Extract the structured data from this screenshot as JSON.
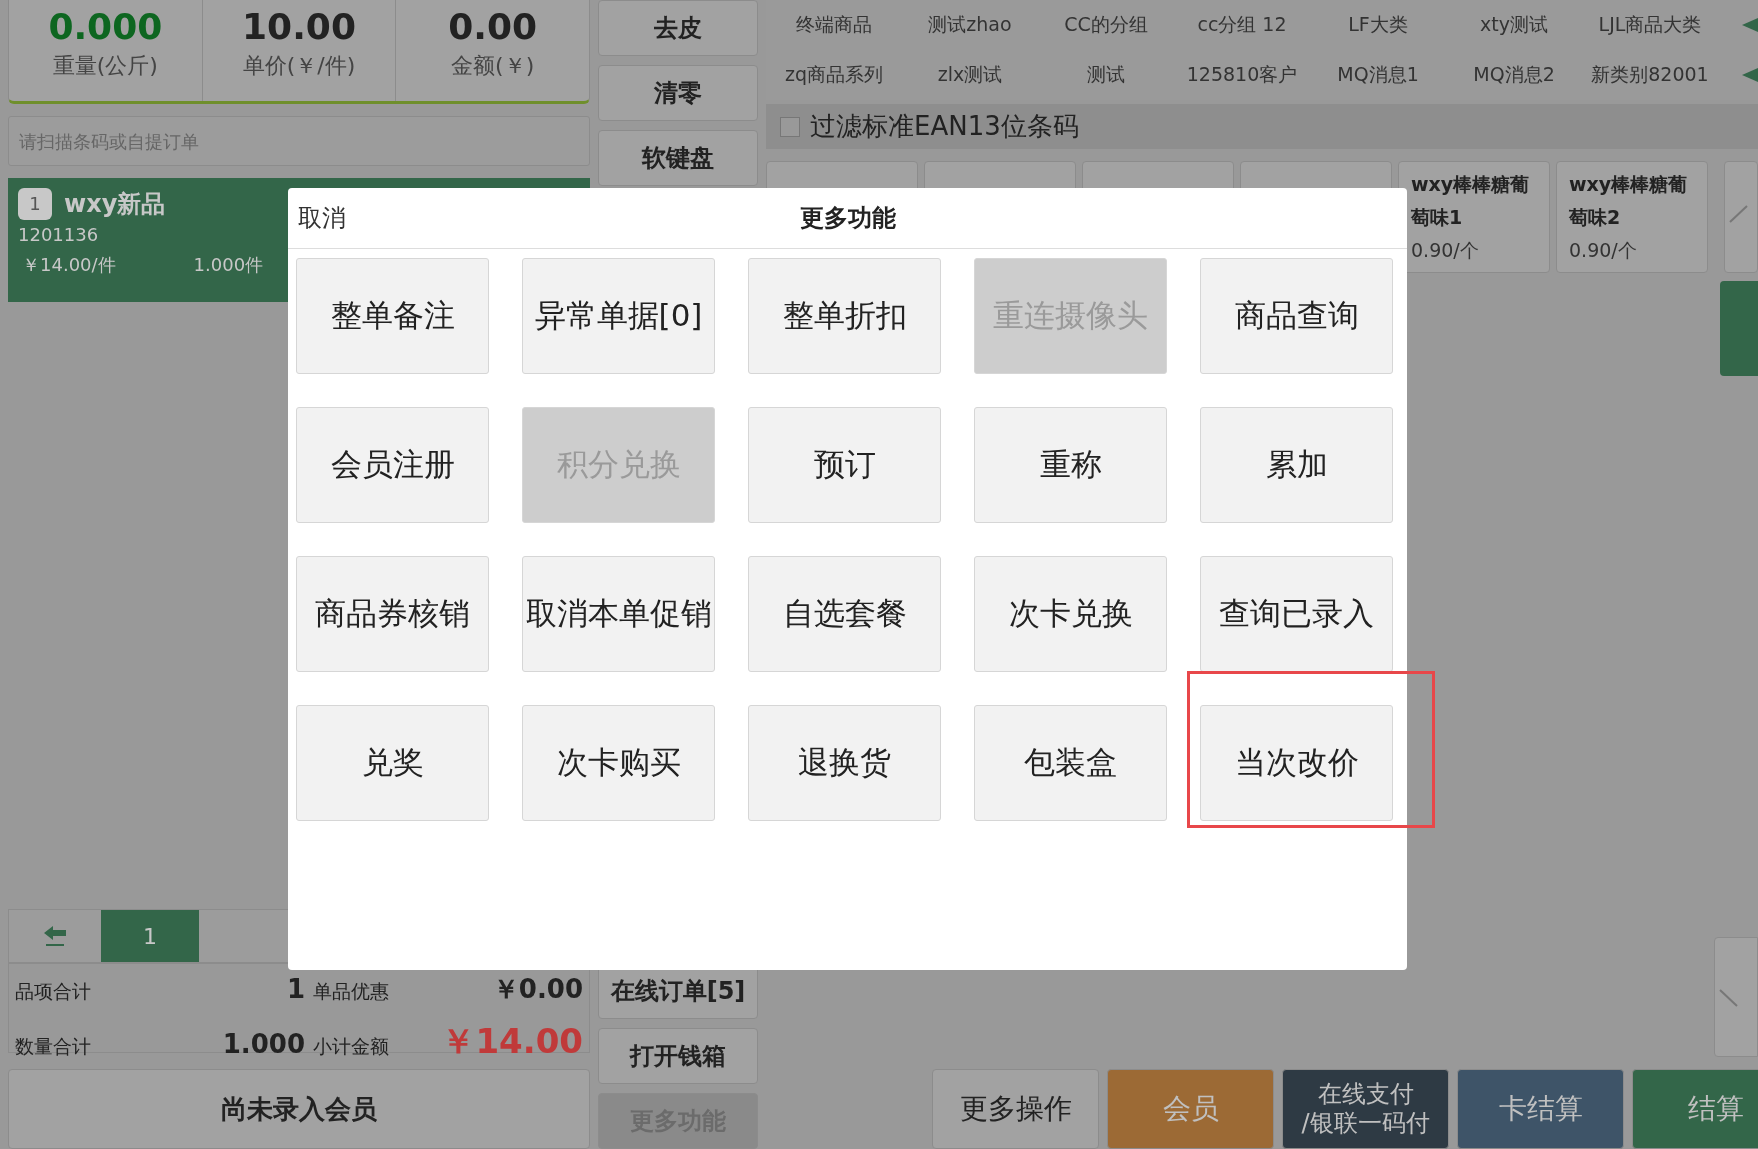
{
  "scale": [
    {
      "value": "0.000",
      "label": "重量(公斤)",
      "kind": "weight"
    },
    {
      "value": "10.00",
      "label": "单价(￥/件)",
      "kind": "plain"
    },
    {
      "value": "0.00",
      "label": "金额(￥)",
      "kind": "plain"
    }
  ],
  "search": {
    "placeholder": "请扫描条码或自提订单"
  },
  "order_items": [
    {
      "index": "1",
      "name": "wxy新品",
      "code": "1201136",
      "price": "￥14.00/件",
      "qty": "1.000件",
      "selected": true
    }
  ],
  "pager": {
    "pages": [
      {
        "label": "1",
        "selected": true
      }
    ]
  },
  "summary": [
    {
      "label": "品项合计",
      "value": "1",
      "label2": "单品优惠",
      "value2": "￥0.00",
      "kind": "plain"
    },
    {
      "label": "数量合计",
      "value": "1.000",
      "label2": "小计金额",
      "value2": "￥14.00",
      "kind": "total"
    }
  ],
  "member_button": "尚未录入会员",
  "side_buttons": [
    {
      "label": "去皮",
      "disabled": false
    },
    {
      "label": "清零",
      "disabled": false
    },
    {
      "label": "软键盘",
      "disabled": false
    }
  ],
  "side_buttons_bottom": [
    {
      "label": "在线订单[5]",
      "disabled": false
    },
    {
      "label": "打开钱箱",
      "disabled": false
    },
    {
      "label": "更多功能",
      "disabled": true
    }
  ],
  "categories": [
    [
      "终端商品",
      "测试zhao",
      "CC的分组",
      "cc分组 12",
      "LF大类",
      "xty测试",
      "LJL商品大类"
    ],
    [
      "zq商品系列",
      "zlx测试",
      "测试",
      "125810客户",
      "MQ消息1",
      "MQ消息2",
      "新类别82001"
    ]
  ],
  "filter": {
    "label": "过滤标准EAN13位条码",
    "checked": false
  },
  "products": [
    {
      "name": "wxy棒棒糖葡萄味1",
      "price": "0.90/个"
    },
    {
      "name": "wxy棒棒糖葡萄味2",
      "price": "0.90/个"
    }
  ],
  "actions": [
    {
      "label": "更多操作",
      "kind": "plain"
    },
    {
      "label": "会员",
      "kind": "member"
    },
    {
      "label": "在线支付\n/银联一码付",
      "kind": "online"
    },
    {
      "label": "卡结算",
      "kind": "card"
    },
    {
      "label": "结算",
      "kind": "pay"
    }
  ],
  "dialog": {
    "cancel": "取消",
    "title": "更多功能",
    "buttons": [
      {
        "label": "整单备注",
        "disabled": false,
        "highlighted": false
      },
      {
        "label": "异常单据[0]",
        "disabled": false,
        "highlighted": false
      },
      {
        "label": "整单折扣",
        "disabled": false,
        "highlighted": false
      },
      {
        "label": "重连摄像头",
        "disabled": true,
        "highlighted": false
      },
      {
        "label": "商品查询",
        "disabled": false,
        "highlighted": false
      },
      {
        "label": "会员注册",
        "disabled": false,
        "highlighted": false
      },
      {
        "label": "积分兑换",
        "disabled": true,
        "highlighted": false
      },
      {
        "label": "预订",
        "disabled": false,
        "highlighted": false
      },
      {
        "label": "重称",
        "disabled": false,
        "highlighted": false
      },
      {
        "label": "累加",
        "disabled": false,
        "highlighted": false
      },
      {
        "label": "商品券核销",
        "disabled": false,
        "highlighted": false
      },
      {
        "label": "取消本单促销",
        "disabled": false,
        "highlighted": false
      },
      {
        "label": "自选套餐",
        "disabled": false,
        "highlighted": false
      },
      {
        "label": "次卡兑换",
        "disabled": false,
        "highlighted": false
      },
      {
        "label": "查询已录入",
        "disabled": false,
        "highlighted": false
      },
      {
        "label": "兑奖",
        "disabled": false,
        "highlighted": false
      },
      {
        "label": "次卡购买",
        "disabled": false,
        "highlighted": false
      },
      {
        "label": "退换货",
        "disabled": false,
        "highlighted": false
      },
      {
        "label": "包装盒",
        "disabled": false,
        "highlighted": false
      },
      {
        "label": "当次改价",
        "disabled": false,
        "highlighted": true
      }
    ]
  }
}
